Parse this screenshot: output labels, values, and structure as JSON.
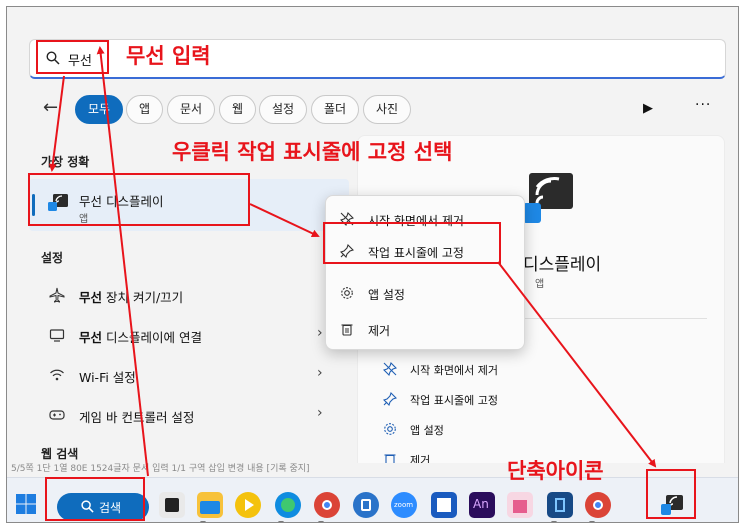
{
  "search": {
    "query": "무선"
  },
  "filters": [
    "모두",
    "앱",
    "문서",
    "웹",
    "설정",
    "폴더",
    "사진"
  ],
  "sections": {
    "best_match": "가장 정확",
    "settings": "설정",
    "web": "웹 검색"
  },
  "best_result": {
    "name": "무선 디스플레이",
    "type": "앱"
  },
  "settings_items": [
    {
      "bold": "무선",
      "rest": " 장치 켜기/끄기",
      "icon": "airplane-icon"
    },
    {
      "bold": "무선",
      "rest": " 디스플레이에 연결",
      "icon": "monitor-icon"
    },
    {
      "bold": "",
      "rest": "Wi-Fi 설정",
      "icon": "wifi-icon"
    },
    {
      "bold": "",
      "rest": "게임 바 컨트롤러 설정",
      "icon": "gamepad-icon"
    }
  ],
  "detail_panel": {
    "title": "디스플레이",
    "subtitle": "앱",
    "actions": [
      "시작 화면에서 제거",
      "작업 표시줄에 고정",
      "앱 설정",
      "제거"
    ]
  },
  "context_menu": [
    "시작 화면에서 제거",
    "작업 표시줄에 고정",
    "앱 설정",
    "제거"
  ],
  "taskbar": {
    "search_label": "검색"
  },
  "annotations": {
    "enter_wireless": "무선 입력",
    "right_click": "우클릭 작업 표시줄에 고정 선택",
    "shortcut_icon": "단축아이콘"
  },
  "colors": {
    "accent": "#0f6cbd",
    "annotation": "#e8141b"
  }
}
